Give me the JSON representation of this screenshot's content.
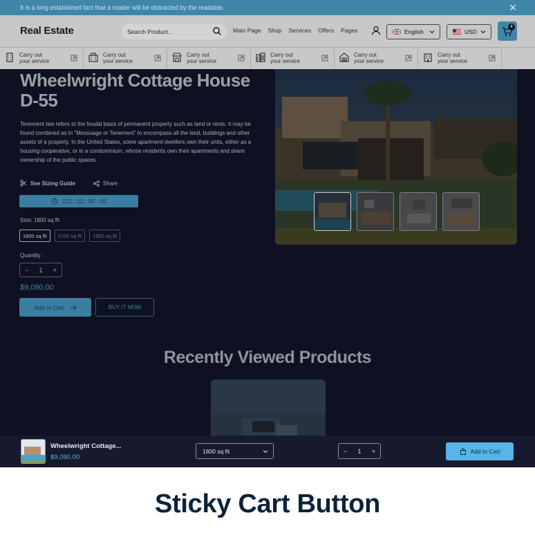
{
  "announcement": {
    "text": "It is a long established fact that a reader will be distracted by the readable.",
    "close_icon": "close-icon"
  },
  "header": {
    "logo": "Real Estate",
    "search_placeholder": "Search Product...",
    "nav": [
      "Main Page",
      "Shop",
      "Services",
      "Offers",
      "Pages"
    ],
    "language": "English",
    "currency": "USD",
    "cart_count": "4"
  },
  "features": [
    {
      "line1": "Carry out",
      "line2": "your service",
      "icon": "building-icon"
    },
    {
      "line1": "Carry out",
      "line2": "your service",
      "icon": "office-icon"
    },
    {
      "line1": "Carry out",
      "line2": "your service",
      "icon": "store-icon"
    },
    {
      "line1": "Carry out",
      "line2": "your service",
      "icon": "tower-icon"
    },
    {
      "line1": "Carry out",
      "line2": "your service",
      "icon": "garage-icon"
    },
    {
      "line1": "Carry out",
      "line2": "your service",
      "icon": "apartment-icon"
    }
  ],
  "product": {
    "title": "Wheelwright Cottage House D-55",
    "description": "Tenement law refers to the feudal basis of permanent property such as land or rents. It may be found combined as in \"Messuage or Tenement\" to encompass all the land, buildings and other assets of a property. In the United States, some apartment-dwellers own their units, either as a housing cooperative, or in a condominium, whose residents own their apartments and share ownership of the public spaces.",
    "sizing_guide": "See Sizing Guide",
    "share": "Share",
    "timer": "212 : 12 : 05 : 05",
    "size_label": "Size: 1800 sq flt",
    "sizes": [
      "1800 sq flt",
      "1700 sq flt",
      "1900 sq flt"
    ],
    "quantity_label": "Quantity :",
    "quantity": "1",
    "price": "$9,090.00",
    "add_to_cart": "Add to Cart",
    "buy_now": "BUY IT NOW"
  },
  "recently_viewed": {
    "title": "Recently Viewed Products"
  },
  "sticky": {
    "name": "Wheelwright Cottage...",
    "price": "$9,090.00",
    "size": "1800 sq flt",
    "quantity": "1",
    "add_to_cart": "Add to Cart"
  },
  "caption": "Sticky Cart Button",
  "colors": {
    "accent": "#3f86a8",
    "sticky_accent": "#57b4e6",
    "dark_bg": "#0f1122",
    "caption": "#0b2238"
  }
}
